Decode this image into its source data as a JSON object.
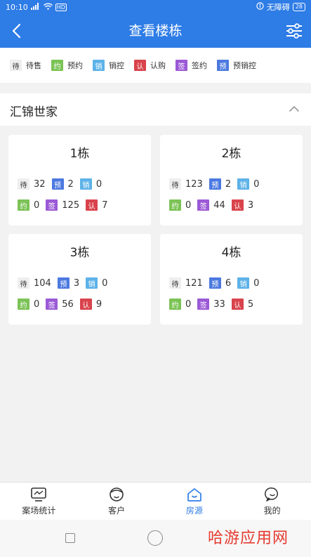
{
  "status_bar": {
    "time": "10:10",
    "network": "HD",
    "accessibility": "无障碍",
    "battery": "28"
  },
  "header": {
    "title": "查看楼栋"
  },
  "legend": [
    {
      "tag": "待",
      "label": "待售",
      "type": "wait"
    },
    {
      "tag": "约",
      "label": "预约",
      "type": "contract"
    },
    {
      "tag": "销",
      "label": "销控",
      "type": "ctrl"
    },
    {
      "tag": "认",
      "label": "认购",
      "type": "buy"
    },
    {
      "tag": "签",
      "label": "签约",
      "type": "sign"
    },
    {
      "tag": "预",
      "label": "预销控",
      "type": "pre"
    }
  ],
  "project": {
    "name": "汇锦世家"
  },
  "tags": {
    "wait": "待",
    "pre": "预",
    "ctrl": "销",
    "contract": "约",
    "sign": "签",
    "buy": "认"
  },
  "buildings": [
    {
      "name": "1栋",
      "wait": "32",
      "pre": "2",
      "ctrl": "0",
      "contract": "0",
      "sign": "125",
      "buy": "7"
    },
    {
      "name": "2栋",
      "wait": "123",
      "pre": "2",
      "ctrl": "0",
      "contract": "0",
      "sign": "44",
      "buy": "3"
    },
    {
      "name": "3栋",
      "wait": "104",
      "pre": "3",
      "ctrl": "0",
      "contract": "0",
      "sign": "56",
      "buy": "9"
    },
    {
      "name": "4栋",
      "wait": "121",
      "pre": "6",
      "ctrl": "0",
      "contract": "0",
      "sign": "33",
      "buy": "5"
    }
  ],
  "bottom_nav": [
    {
      "label": "案场统计",
      "icon": "monitor-icon",
      "active": false
    },
    {
      "label": "客户",
      "icon": "face-icon",
      "active": false
    },
    {
      "label": "房源",
      "icon": "house-icon",
      "active": true
    },
    {
      "label": "我的",
      "icon": "user-chat-icon",
      "active": false
    }
  ],
  "watermark": "哈游应用网",
  "colors": {
    "primary": "#2e7ce6",
    "pre": "#4c79e0",
    "ctrl": "#5db2e8",
    "contract": "#7cc356",
    "sign": "#9b59d6",
    "buy": "#d9434c"
  }
}
